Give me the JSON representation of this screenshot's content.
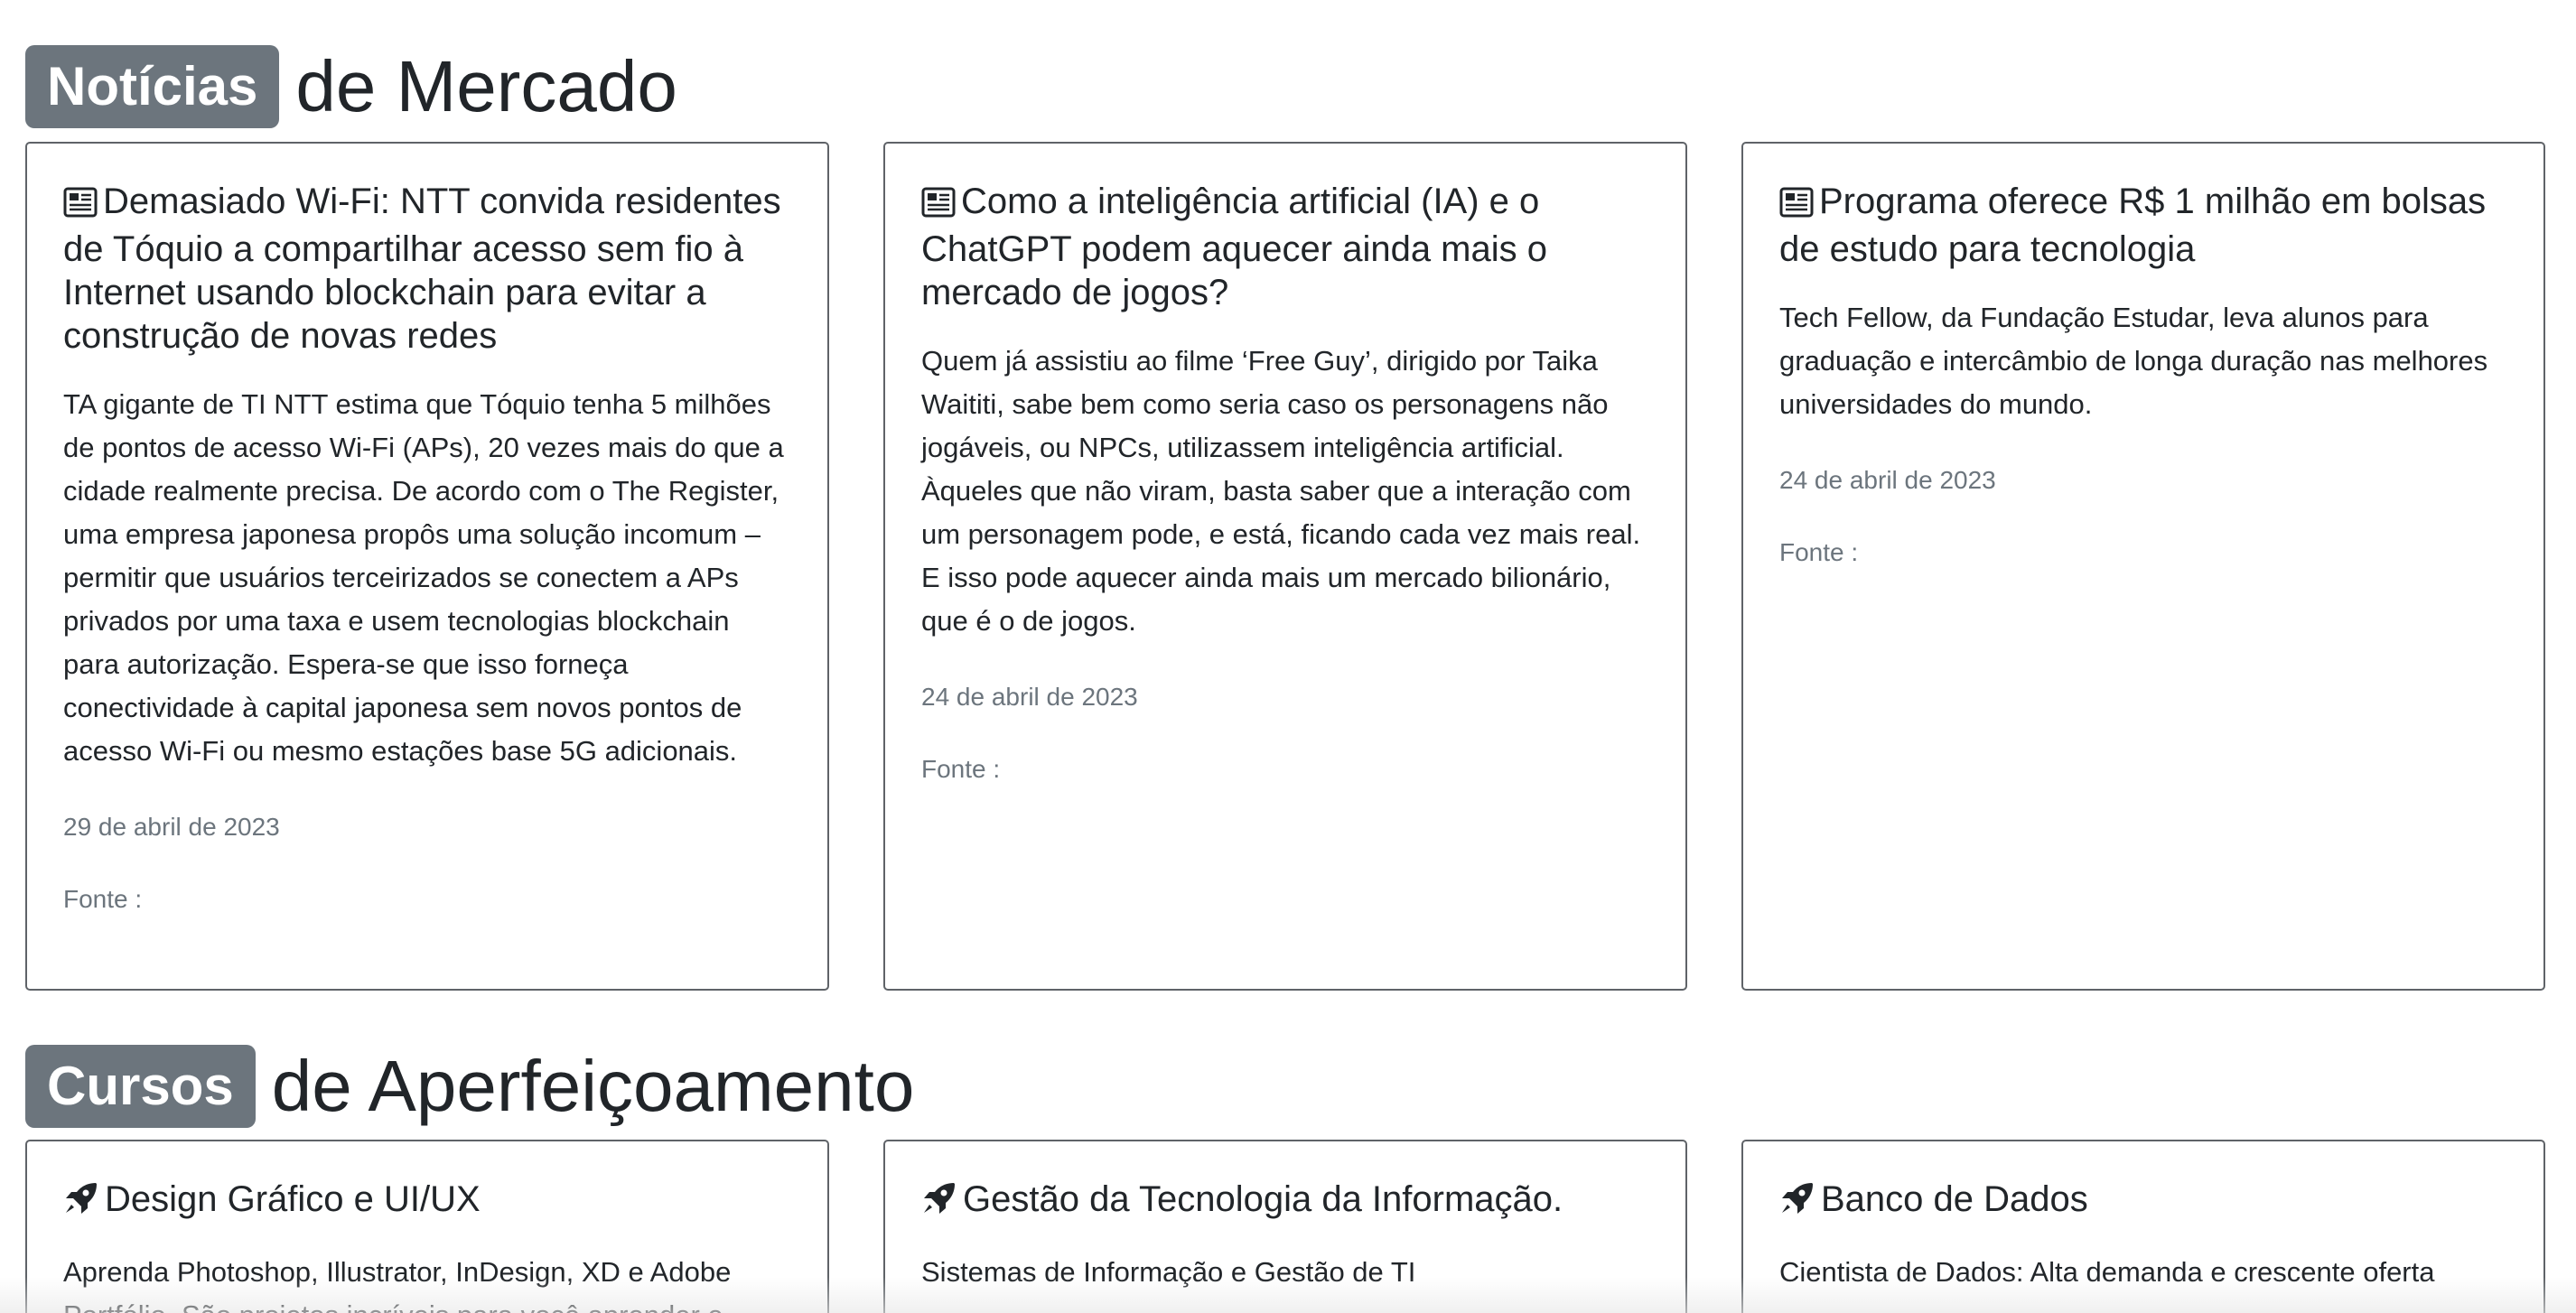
{
  "news_section": {
    "badge": "Notícias",
    "title_rest": "de Mercado",
    "cards": [
      {
        "icon": "newspaper-icon",
        "title": "Demasiado Wi-Fi: NTT convida residentes de Tóquio a compartilhar acesso sem fio à Internet usando blockchain para evitar a construção de novas redes",
        "text": "TA gigante de TI NTT estima que Tóquio tenha 5 milhões de pontos de acesso Wi-Fi (APs), 20 vezes mais do que a cidade realmente precisa. De acordo com o The Register, uma empresa japonesa propôs uma solução incomum – permitir que usuários terceirizados se conectem a APs privados por uma taxa e usem tecnologias blockchain para autorização. Espera-se que isso forneça conectividade à capital japonesa sem novos pontos de acesso Wi-Fi ou mesmo estações base 5G adicionais.",
        "date": "29 de abril de 2023",
        "source": "Fonte :"
      },
      {
        "icon": "newspaper-icon",
        "title": "Como a inteligência artificial (IA) e o ChatGPT podem aquecer ainda mais o mercado de jogos?",
        "text": "Quem já assistiu ao filme ‘Free Guy’, dirigido por Taika Waititi, sabe bem como seria caso os personagens não jogáveis, ou NPCs, utilizassem inteligência artificial. Àqueles que não viram, basta saber que a interação com um personagem pode, e está, ficando cada vez mais real. E isso pode aquecer ainda mais um mercado bilionário, que é o de jogos.",
        "date": "24 de abril de 2023",
        "source": "Fonte :"
      },
      {
        "icon": "newspaper-icon",
        "title": "Programa oferece R$ 1 milhão em bolsas de estudo para tecnologia",
        "text": "Tech Fellow, da Fundação Estudar, leva alunos para graduação e intercâmbio de longa duração nas melhores universidades do mundo.",
        "date": "24 de abril de 2023",
        "source": "Fonte :"
      }
    ]
  },
  "courses_section": {
    "badge": "Cursos",
    "title_rest": "de Aperfeiçoamento",
    "cards": [
      {
        "icon": "rocket-icon",
        "title": "Design Gráfico e UI/UX",
        "text": "Aprenda Photoshop, Illustrator, InDesign, XD e Adobe Portfólio. São projetos incríveis para você aprender e"
      },
      {
        "icon": "rocket-icon",
        "title": "Gestão da Tecnologia da Informação.",
        "text": "Sistemas de Informação e Gestão de TI"
      },
      {
        "icon": "rocket-icon",
        "title": "Banco de Dados",
        "text": "Cientista de Dados: Alta demanda e crescente oferta"
      }
    ]
  }
}
